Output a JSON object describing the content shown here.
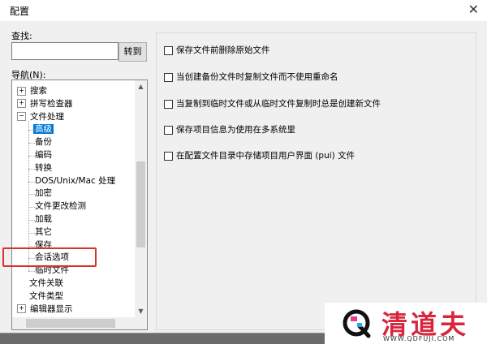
{
  "window": {
    "title": "配置",
    "close_glyph": "✕"
  },
  "search": {
    "label": "查找:",
    "value": "",
    "button": "转到"
  },
  "nav": {
    "label": "导航(N):",
    "items": [
      {
        "label": "搜索",
        "level": 0,
        "exp": "+"
      },
      {
        "label": "拼写检查器",
        "level": 0,
        "exp": "+"
      },
      {
        "label": "文件处理",
        "level": 0,
        "exp": "−"
      },
      {
        "label": "高级",
        "level": 1,
        "selected": true
      },
      {
        "label": "备份",
        "level": 1
      },
      {
        "label": "编码",
        "level": 1
      },
      {
        "label": "转换",
        "level": 1
      },
      {
        "label": "DOS/Unix/Mac 处理",
        "level": 1
      },
      {
        "label": "加密",
        "level": 1
      },
      {
        "label": "文件更改检测",
        "level": 1
      },
      {
        "label": "加载",
        "level": 1
      },
      {
        "label": "其它",
        "level": 1
      },
      {
        "label": "保存",
        "level": 1
      },
      {
        "label": "会话选项",
        "level": 1
      },
      {
        "label": "临时文件",
        "level": 1
      },
      {
        "label": "文件关联",
        "level": 0
      },
      {
        "label": "文件类型",
        "level": 0
      },
      {
        "label": "编辑器显示",
        "level": 0,
        "exp": "+"
      }
    ]
  },
  "options": [
    {
      "label": "保存文件前删除原始文件",
      "checked": false
    },
    {
      "label": "当创建备份文件时复制文件而不使用重命名",
      "checked": false
    },
    {
      "label": "当复制到临时文件或从临时文件复制时总是创建新文件",
      "checked": false
    },
    {
      "label": "保存项目信息为使用在多系统里",
      "checked": false
    },
    {
      "label": "在配置文件目录中存储项目用户界面 (pui) 文件",
      "checked": false
    }
  ],
  "watermark": {
    "brand": "清道夫",
    "url": "WWW.QDFUJI.COM"
  },
  "colors": {
    "selection": "#0078d7",
    "highlight_border": "#d9342b",
    "brand": "#d7263d"
  }
}
